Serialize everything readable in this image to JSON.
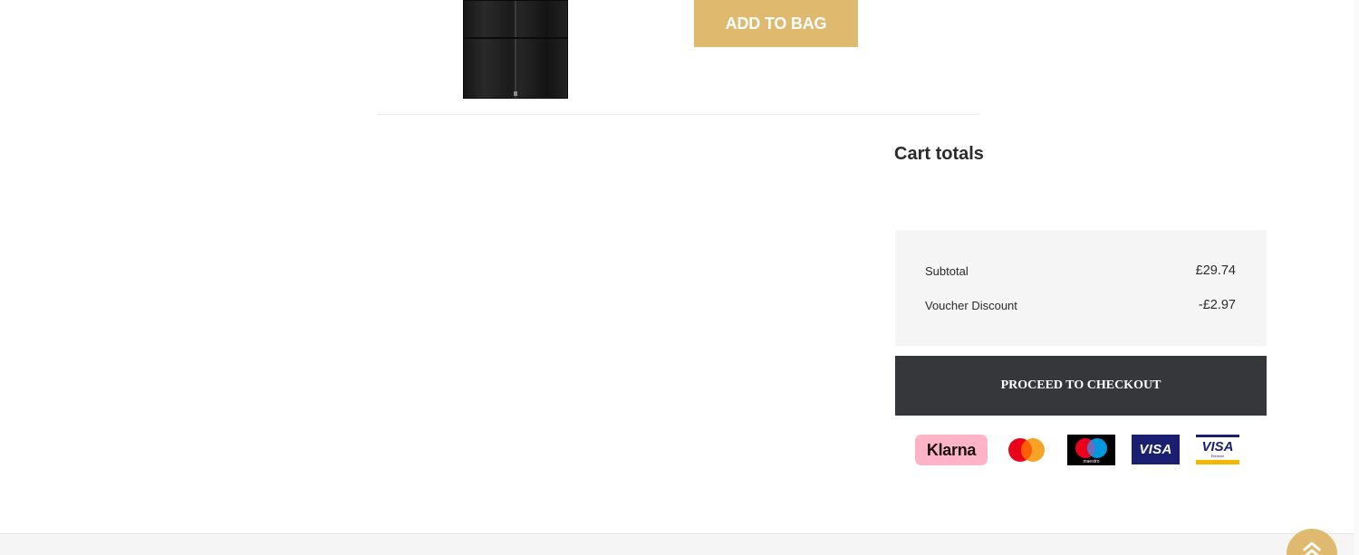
{
  "product": {
    "add_to_bag_label": "ADD TO BAG"
  },
  "cart_totals": {
    "title": "Cart totals",
    "rows": [
      {
        "label": "Subtotal",
        "value": "£29.74"
      },
      {
        "label": "Voucher Discount",
        "value": "-£2.97"
      }
    ],
    "checkout_label": "PROCEED TO CHECKOUT"
  },
  "payment_methods": {
    "klarna": "Klarna",
    "maestro": "maestro",
    "visa": "VISA",
    "visa_electron": "VISA",
    "visa_electron_sub": "Electron"
  },
  "colors": {
    "gold_accent": "#dfba6e",
    "checkout_bg": "#36373b",
    "totals_bg": "#f5f5f5",
    "klarna_pink": "#ffb3c7",
    "visa_blue": "#1a1f71"
  },
  "icons": {
    "scroll_top": "chevron-double-up-icon"
  }
}
